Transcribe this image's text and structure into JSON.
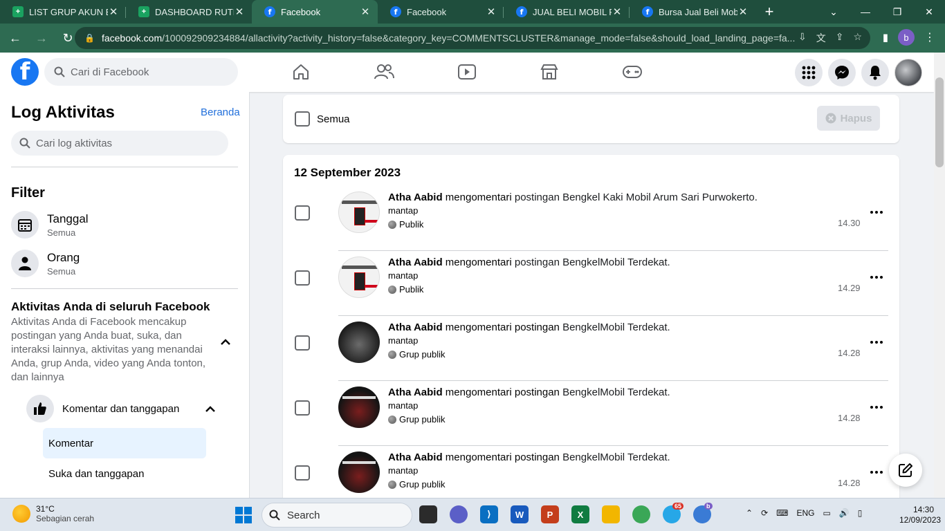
{
  "browser": {
    "tabs": [
      {
        "label": "LIST GRUP AKUN BEN",
        "icon": "sheets-icon",
        "active": false
      },
      {
        "label": "DASHBOARD RUTINIT",
        "icon": "sheets-icon",
        "active": false
      },
      {
        "label": "Facebook",
        "icon": "facebook-icon",
        "active": true
      },
      {
        "label": "Facebook",
        "icon": "facebook-icon",
        "active": false
      },
      {
        "label": "JUAL BELI MOBIL PUR",
        "icon": "facebook-icon",
        "active": false
      },
      {
        "label": "Bursa Jual Beli Mobil",
        "icon": "facebook-icon",
        "active": false
      }
    ],
    "url_domain": "facebook.com",
    "url_path": "/100092909234884/allactivity?activity_history=false&category_key=COMMENTSCLUSTER&manage_mode=false&should_load_landing_page=fa...",
    "profile_initial": "b"
  },
  "fb": {
    "search_placeholder": "Cari di Facebook",
    "logo_letter": "f"
  },
  "sidebar": {
    "title": "Log Aktivitas",
    "home_link": "Beranda",
    "search_placeholder": "Cari log aktivitas",
    "filter_title": "Filter",
    "filters": [
      {
        "label": "Tanggal",
        "sub": "Semua"
      },
      {
        "label": "Orang",
        "sub": "Semua"
      }
    ],
    "activity_title": "Aktivitas Anda di seluruh Facebook",
    "activity_desc": "Aktivitas Anda di Facebook mencakup postingan yang Anda buat, suka, dan interaksi lainnya, aktivitas yang menandai Anda, grup Anda, video yang Anda tonton, dan lainnya",
    "category": "Komentar dan tanggapan",
    "sub_active": "Komentar",
    "sub_other": "Suka dan tanggapan"
  },
  "main": {
    "select_all": "Semua",
    "delete_button": "Hapus",
    "date_header": "12 September 2023",
    "entries": [
      {
        "actor": "Atha Aabid",
        "verb": "mengomentari",
        "target": "postingan Bengkel Kaki Mobil Arum Sari Purwokerto.",
        "comment": "mantap",
        "privacy": "Publik",
        "time": "14.30",
        "thumb": "poster"
      },
      {
        "actor": "Atha Aabid",
        "verb": "mengomentari",
        "target": "postingan BengkelMobil Terdekat.",
        "comment": "mantap",
        "privacy": "Publik",
        "time": "14.29",
        "thumb": "poster"
      },
      {
        "actor": "Atha Aabid",
        "verb": "mengomentari postingan",
        "target": "BengkelMobil Terdekat.",
        "comment": "mantap",
        "privacy": "Grup publik",
        "time": "14.28",
        "thumb": "dark"
      },
      {
        "actor": "Atha Aabid",
        "verb": "mengomentari postingan",
        "target": "BengkelMobil Terdekat.",
        "comment": "mantap",
        "privacy": "Grup publik",
        "time": "14.28",
        "thumb": "darkred"
      },
      {
        "actor": "Atha Aabid",
        "verb": "mengomentari postingan",
        "target": "BengkelMobil Terdekat.",
        "comment": "mantap",
        "privacy": "Grup publik",
        "time": "14.28",
        "thumb": "darkred"
      }
    ]
  },
  "taskbar": {
    "temp": "31°C",
    "weather": "Sebagian cerah",
    "search_label": "Search",
    "lang": "ENG",
    "time": "14:30",
    "date": "12/09/2023",
    "telegram_badge": "65",
    "chrome_badge": "b"
  },
  "colors": {
    "fb_blue": "#1877f2",
    "chrome_green": "#2e6b52"
  }
}
